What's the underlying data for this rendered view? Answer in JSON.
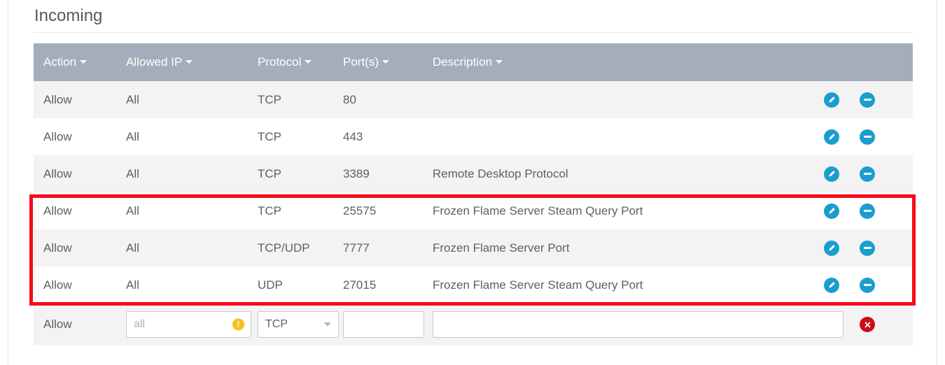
{
  "panel": {
    "title": "Incoming"
  },
  "table": {
    "columns": [
      {
        "label": "Action",
        "sortable": true
      },
      {
        "label": "Allowed IP",
        "sortable": true
      },
      {
        "label": "Protocol",
        "sortable": true
      },
      {
        "label": "Port(s)",
        "sortable": true
      },
      {
        "label": "Description",
        "sortable": true
      },
      {
        "label": "",
        "sortable": false
      }
    ],
    "rows": [
      {
        "action": "Allow",
        "ip": "All",
        "protocol": "TCP",
        "ports": "80",
        "description": "",
        "highlighted": false
      },
      {
        "action": "Allow",
        "ip": "All",
        "protocol": "TCP",
        "ports": "443",
        "description": "",
        "highlighted": false
      },
      {
        "action": "Allow",
        "ip": "All",
        "protocol": "TCP",
        "ports": "3389",
        "description": "Remote Desktop Protocol",
        "highlighted": false
      },
      {
        "action": "Allow",
        "ip": "All",
        "protocol": "TCP",
        "ports": "25575",
        "description": "Frozen Flame Server Steam Query Port",
        "highlighted": true
      },
      {
        "action": "Allow",
        "ip": "All",
        "protocol": "TCP/UDP",
        "ports": "7777",
        "description": "Frozen Flame Server Port",
        "highlighted": true
      },
      {
        "action": "Allow",
        "ip": "All",
        "protocol": "UDP",
        "ports": "27015",
        "description": "Frozen Flame Server Steam Query Port",
        "highlighted": true
      }
    ],
    "row_icons": {
      "edit": "pencil-icon",
      "remove": "minus-circle-icon"
    }
  },
  "editor_row": {
    "action_label": "Allow",
    "ip_value": "",
    "ip_placeholder": "all",
    "ip_warning_icon": "warning-exclamation-icon",
    "protocol_value": "TCP",
    "protocol_caret_icon": "chevron-down-icon",
    "ports_value": "",
    "ports_placeholder": "",
    "description_value": "",
    "description_placeholder": "",
    "confirm_icon": "check-circle-icon",
    "cancel_icon": "x-circle-icon"
  },
  "colors": {
    "header_bg": "#a5adba",
    "row_stripe": "#f3f3f4",
    "icon_blue": "#1b9dd0",
    "icon_green": "#77cb8a",
    "icon_red": "#c9101a",
    "warning_yellow": "#f5c11e",
    "highlight_border": "#f8091a",
    "text": "#5b6166"
  }
}
